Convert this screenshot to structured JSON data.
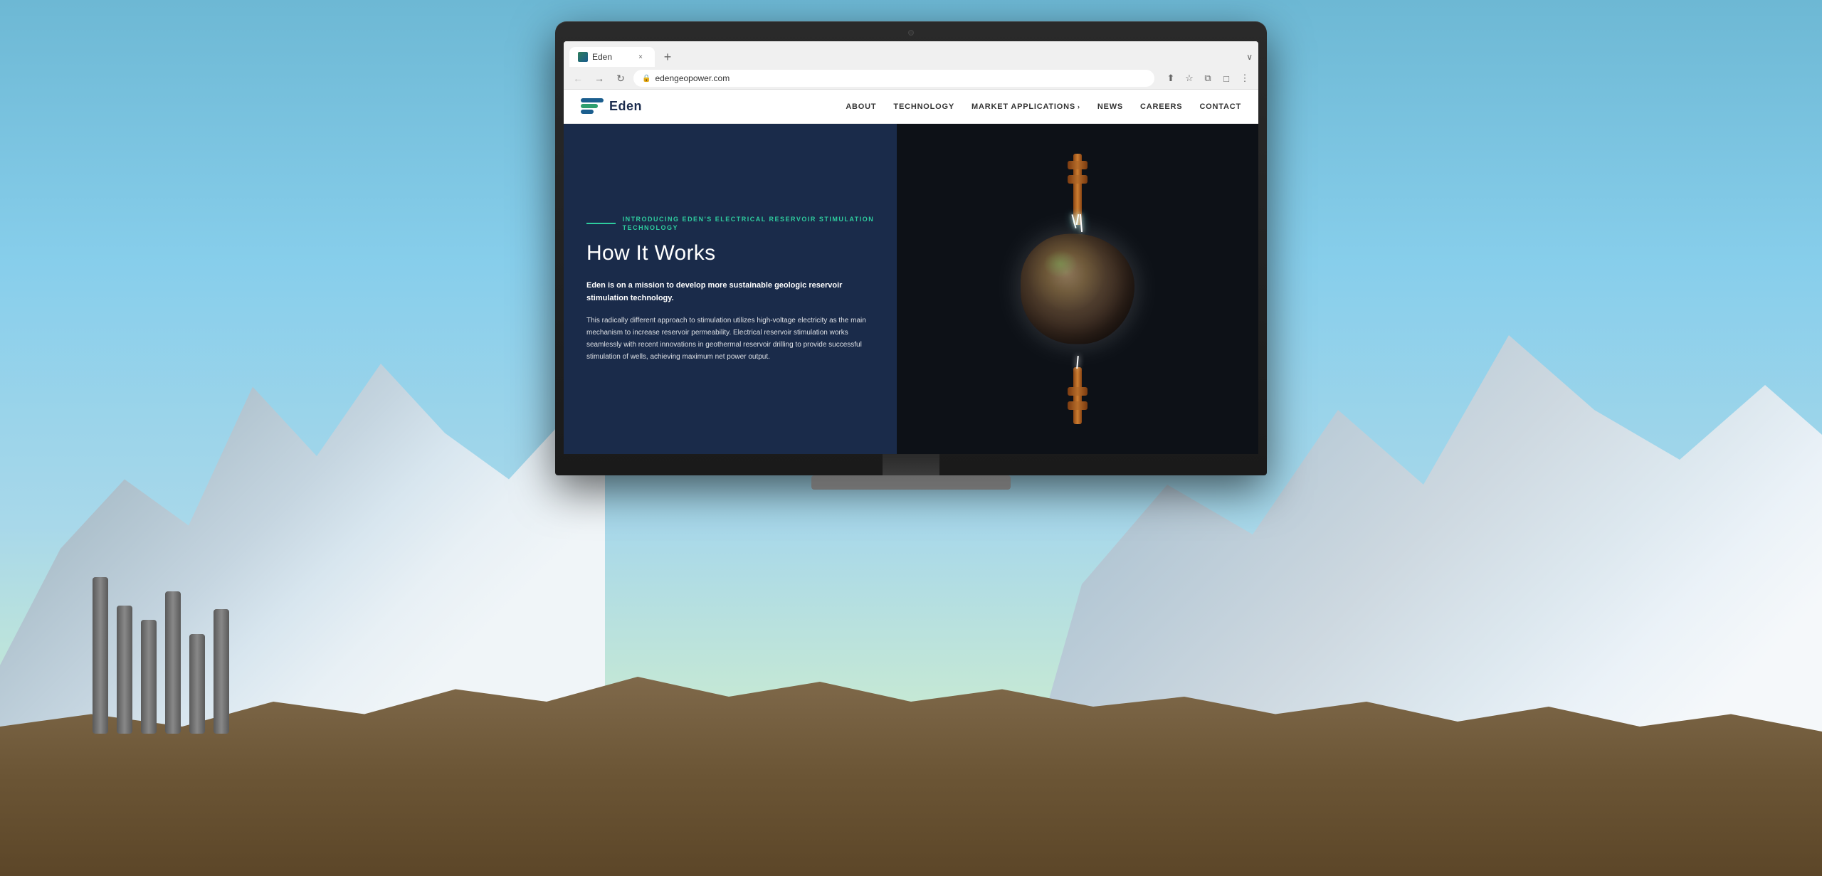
{
  "background": {
    "sky_color": "#87CEEB",
    "mountain_color": "#9BB0C0"
  },
  "browser": {
    "tab_title": "Eden",
    "url": "edengeopower.com",
    "tab_close": "×",
    "tab_new": "+",
    "nav_back": "←",
    "nav_forward": "→",
    "nav_reload": "↻",
    "lock_symbol": "🔒",
    "more_options": "⋮"
  },
  "nav": {
    "logo_text": "Eden",
    "links": [
      {
        "label": "ABOUT",
        "has_dropdown": false
      },
      {
        "label": "TECHNOLOGY",
        "has_dropdown": false
      },
      {
        "label": "MARKET APPLICATIONS",
        "has_dropdown": true
      },
      {
        "label": "NEWS",
        "has_dropdown": false
      },
      {
        "label": "CAREERS",
        "has_dropdown": false
      },
      {
        "label": "CONTACT",
        "has_dropdown": false
      }
    ]
  },
  "hero": {
    "tagline": "INTRODUCING EDEN'S ELECTRICAL RESERVOIR STIMULATION TECHNOLOGY",
    "title": "How It Works",
    "subtitle": "Eden is on a mission to develop more sustainable geologic reservoir stimulation technology.",
    "body": "This radically different approach to stimulation utilizes high-voltage electricity as the main mechanism to increase reservoir permeability. Electrical reservoir stimulation works seamlessly with recent innovations in geothermal reservoir drilling to provide successful stimulation of wells, achieving maximum net power output."
  }
}
